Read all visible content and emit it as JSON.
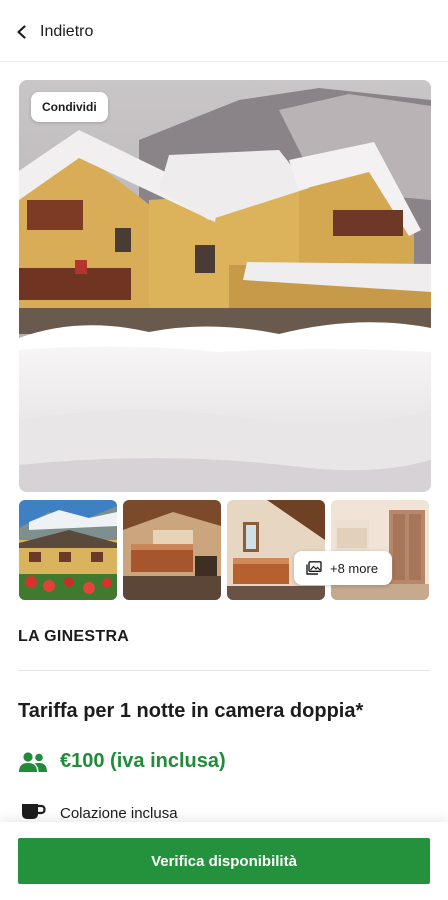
{
  "header": {
    "back_label": "Indietro"
  },
  "gallery": {
    "share_label": "Condividi",
    "more_label": "+8 more",
    "thumbnails": [
      "hotel-summer-exterior",
      "room-double-bed",
      "room-attic-bed",
      "room-wardrobe"
    ]
  },
  "hotel": {
    "name": "LA GINESTRA",
    "rate_title": "Tariffa per 1 notte in camera doppia*",
    "price": "€100 (iva inclusa)",
    "breakfast": "Colazione inclusa"
  },
  "cta": {
    "label": "Verifica disponibilità"
  },
  "colors": {
    "accent_green": "#24923c",
    "price_green": "#228b38"
  }
}
